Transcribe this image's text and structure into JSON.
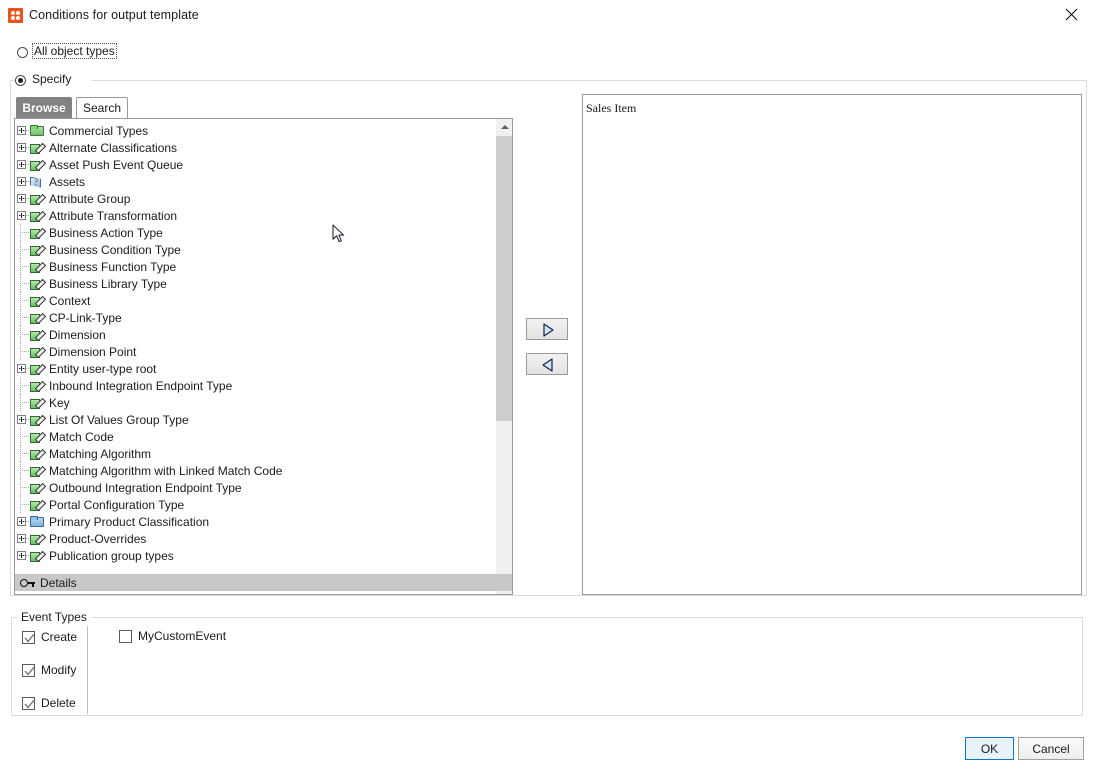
{
  "window": {
    "title": "Conditions for output template",
    "icon": "app-grid-icon",
    "close_label": "×",
    "accent_color": "#e8541e"
  },
  "scope": {
    "all_types": {
      "label": "All object types",
      "selected": false,
      "focused": true
    },
    "specify": {
      "label": "Specify",
      "selected": true
    }
  },
  "tabs": [
    {
      "label": "Browse",
      "selected": true
    },
    {
      "label": "Search",
      "selected": false
    }
  ],
  "tree": {
    "rows": [
      {
        "label": "Commercial Types",
        "icon": "folder-green-icon",
        "expandable": true
      },
      {
        "label": "Alternate Classifications",
        "icon": "note-green-icon",
        "expandable": true
      },
      {
        "label": "Asset Push Event Queue",
        "icon": "note-green-icon",
        "expandable": true
      },
      {
        "label": "Assets",
        "icon": "asset-blue-icon",
        "expandable": true
      },
      {
        "label": "Attribute Group",
        "icon": "note-green-icon",
        "expandable": true
      },
      {
        "label": "Attribute Transformation",
        "icon": "note-green-icon",
        "expandable": true
      },
      {
        "label": "Business Action Type",
        "icon": "note-green-icon",
        "expandable": false
      },
      {
        "label": "Business Condition Type",
        "icon": "note-green-icon",
        "expandable": false
      },
      {
        "label": "Business Function Type",
        "icon": "note-green-icon",
        "expandable": false
      },
      {
        "label": "Business Library Type",
        "icon": "note-green-icon",
        "expandable": false
      },
      {
        "label": "Context",
        "icon": "note-green-icon",
        "expandable": false
      },
      {
        "label": "CP-Link-Type",
        "icon": "note-green-icon",
        "expandable": false
      },
      {
        "label": "Dimension",
        "icon": "note-green-icon",
        "expandable": false
      },
      {
        "label": "Dimension Point",
        "icon": "note-green-icon",
        "expandable": false
      },
      {
        "label": "Entity user-type root",
        "icon": "note-green-icon",
        "expandable": true
      },
      {
        "label": "Inbound Integration Endpoint Type",
        "icon": "note-green-icon",
        "expandable": false
      },
      {
        "label": "Key",
        "icon": "note-green-icon",
        "expandable": false
      },
      {
        "label": "List Of Values Group Type",
        "icon": "note-green-icon",
        "expandable": true
      },
      {
        "label": "Match Code",
        "icon": "note-green-icon",
        "expandable": false
      },
      {
        "label": "Matching Algorithm",
        "icon": "note-green-icon",
        "expandable": false
      },
      {
        "label": "Matching Algorithm with Linked Match Code",
        "icon": "note-green-icon",
        "expandable": false
      },
      {
        "label": "Outbound Integration Endpoint Type",
        "icon": "note-green-icon",
        "expandable": false
      },
      {
        "label": "Portal Configuration Type",
        "icon": "note-green-icon",
        "expandable": false
      },
      {
        "label": "Primary Product Classification",
        "icon": "folder-blue-icon",
        "expandable": true
      },
      {
        "label": "Product-Overrides",
        "icon": "note-green-icon",
        "expandable": true
      },
      {
        "label": "Publication group types",
        "icon": "note-green-icon",
        "expandable": true
      }
    ],
    "details_bar": {
      "label": "Details",
      "icon": "key-icon"
    }
  },
  "transfer": {
    "add_label": "add-to-selection",
    "remove_label": "remove-from-selection"
  },
  "selection": {
    "items": [
      "Sales Item"
    ]
  },
  "event_types": {
    "legend": "Event Types",
    "standard": [
      {
        "label": "Create",
        "checked": true
      },
      {
        "label": "Modify",
        "checked": true
      },
      {
        "label": "Delete",
        "checked": true
      }
    ],
    "custom": [
      {
        "label": "MyCustomEvent",
        "checked": false
      }
    ]
  },
  "footer": {
    "ok_label": "OK",
    "cancel_label": "Cancel"
  }
}
